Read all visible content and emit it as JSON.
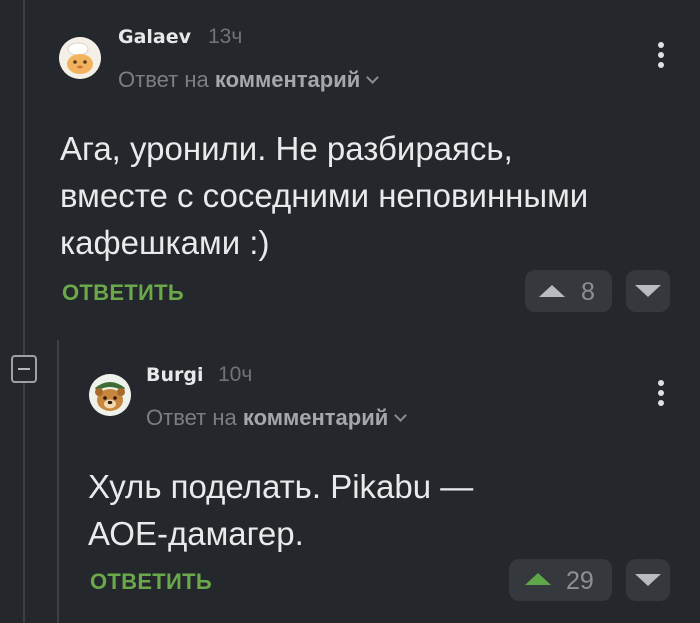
{
  "comments": [
    {
      "username": "Galaev",
      "time": "13ч",
      "reply_prefix": "Ответ на",
      "reply_target": "комментарий",
      "text_lines": [
        "Ага, уронили. Не разбираясь,",
        "вместе с соседними неповинными",
        "кафешками :)"
      ],
      "reply_label": "ОТВЕТИТЬ",
      "rating": "8",
      "avatar_icon": "chef-cat-avatar"
    },
    {
      "username": "Burgi",
      "time": "10ч",
      "reply_prefix": "Ответ на",
      "reply_target": "комментарий",
      "text_lines": [
        "Хуль поделать. Pikabu —",
        "АОЕ-дамагер."
      ],
      "reply_label": "ОТВЕТИТЬ",
      "rating": "29",
      "avatar_icon": "bear-avatar"
    }
  ],
  "colors": {
    "background": "#24272b",
    "accent_green": "#6aa84a",
    "upvoted_green": "#5ea84a",
    "neutral_arrow": "#b8bbbf"
  }
}
